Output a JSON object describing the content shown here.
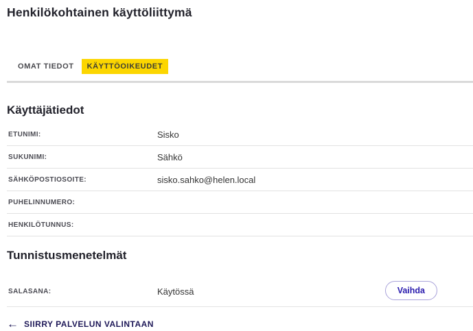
{
  "page": {
    "title": "Henkilökohtainen käyttöliittymä"
  },
  "tabs": [
    {
      "label": "OMAT TIEDOT",
      "active": false
    },
    {
      "label": "KÄYTTÖOIKEUDET",
      "active": true
    }
  ],
  "user_section": {
    "heading": "Käyttäjätiedot",
    "rows": [
      {
        "label": "ETUNIMI:",
        "value": "Sisko"
      },
      {
        "label": "SUKUNIMI:",
        "value": "Sähkö"
      },
      {
        "label": "SÄHKÖPOSTIOSOITE:",
        "value": "sisko.sahko@helen.local"
      },
      {
        "label": "PUHELINNUMERO:",
        "value": ""
      },
      {
        "label": "HENKILÖTUNNUS:",
        "value": ""
      }
    ]
  },
  "auth_section": {
    "heading": "Tunnistusmenetelmät",
    "row": {
      "label": "SALASANA:",
      "value": "Käytössä",
      "action_label": "Vaihda"
    }
  },
  "footer": {
    "back_arrow": "←",
    "back_link": "SIIRRY PALVELUN VALINTAAN"
  },
  "colors": {
    "active_tab_background": "#fcd600",
    "heading_text": "#21212a",
    "label_text": "#4a4a52",
    "value_text": "#333333",
    "button_text": "#2a1cae",
    "button_border": "#a9a2da",
    "link_text": "#1d1757",
    "divider": "#d9d9d9"
  }
}
